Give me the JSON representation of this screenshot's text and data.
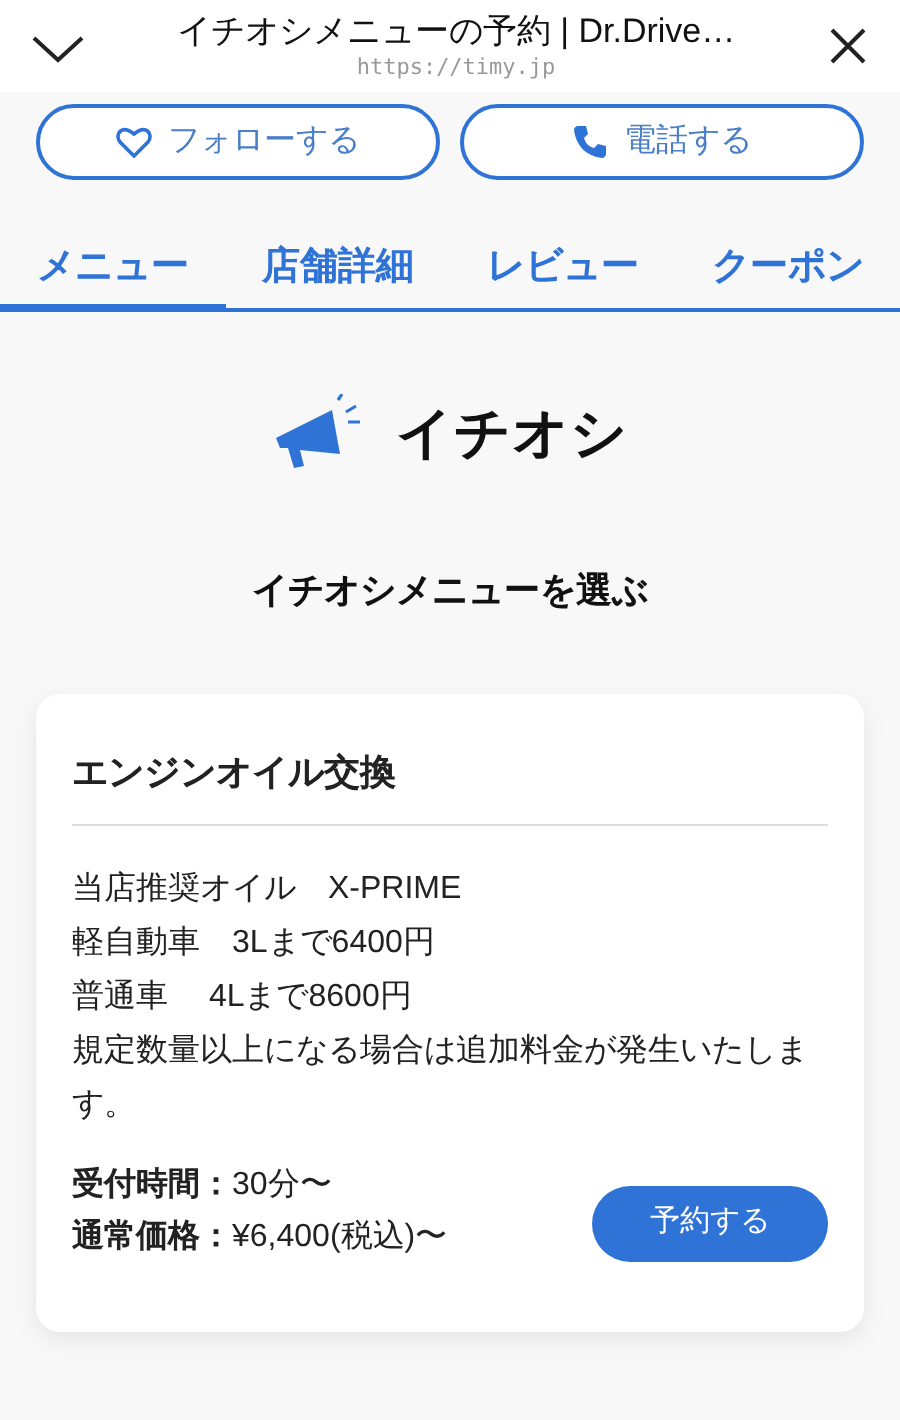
{
  "browser_bar": {
    "title": "イチオシメニューの予約 | Dr.Drive…",
    "url": "https://timy.jp"
  },
  "actions": [
    {
      "kind": "follow",
      "label": "フォローする"
    },
    {
      "kind": "call",
      "label": "電話する"
    }
  ],
  "tabs": [
    {
      "label": "メニュー",
      "selected": true
    },
    {
      "label": "店舗詳細",
      "selected": false
    },
    {
      "label": "レビュー",
      "selected": false
    },
    {
      "label": "クーポン",
      "selected": false
    }
  ],
  "section": {
    "heading": "イチオシ",
    "subheading": "イチオシメニューを選ぶ"
  },
  "menu_card": {
    "title": "エンジンオイル交換",
    "description": [
      "当店推奨オイル　X-PRIME",
      "軽自動車　3Lまで6400円",
      "普通車　 4Lまで8600円",
      "規定数量以上になる場合は追加料金が発生いたします。"
    ],
    "details": [
      "**受付時間：**30分〜",
      "**通常価格：**¥6,400(税込)〜"
    ],
    "button": "予約する"
  }
}
